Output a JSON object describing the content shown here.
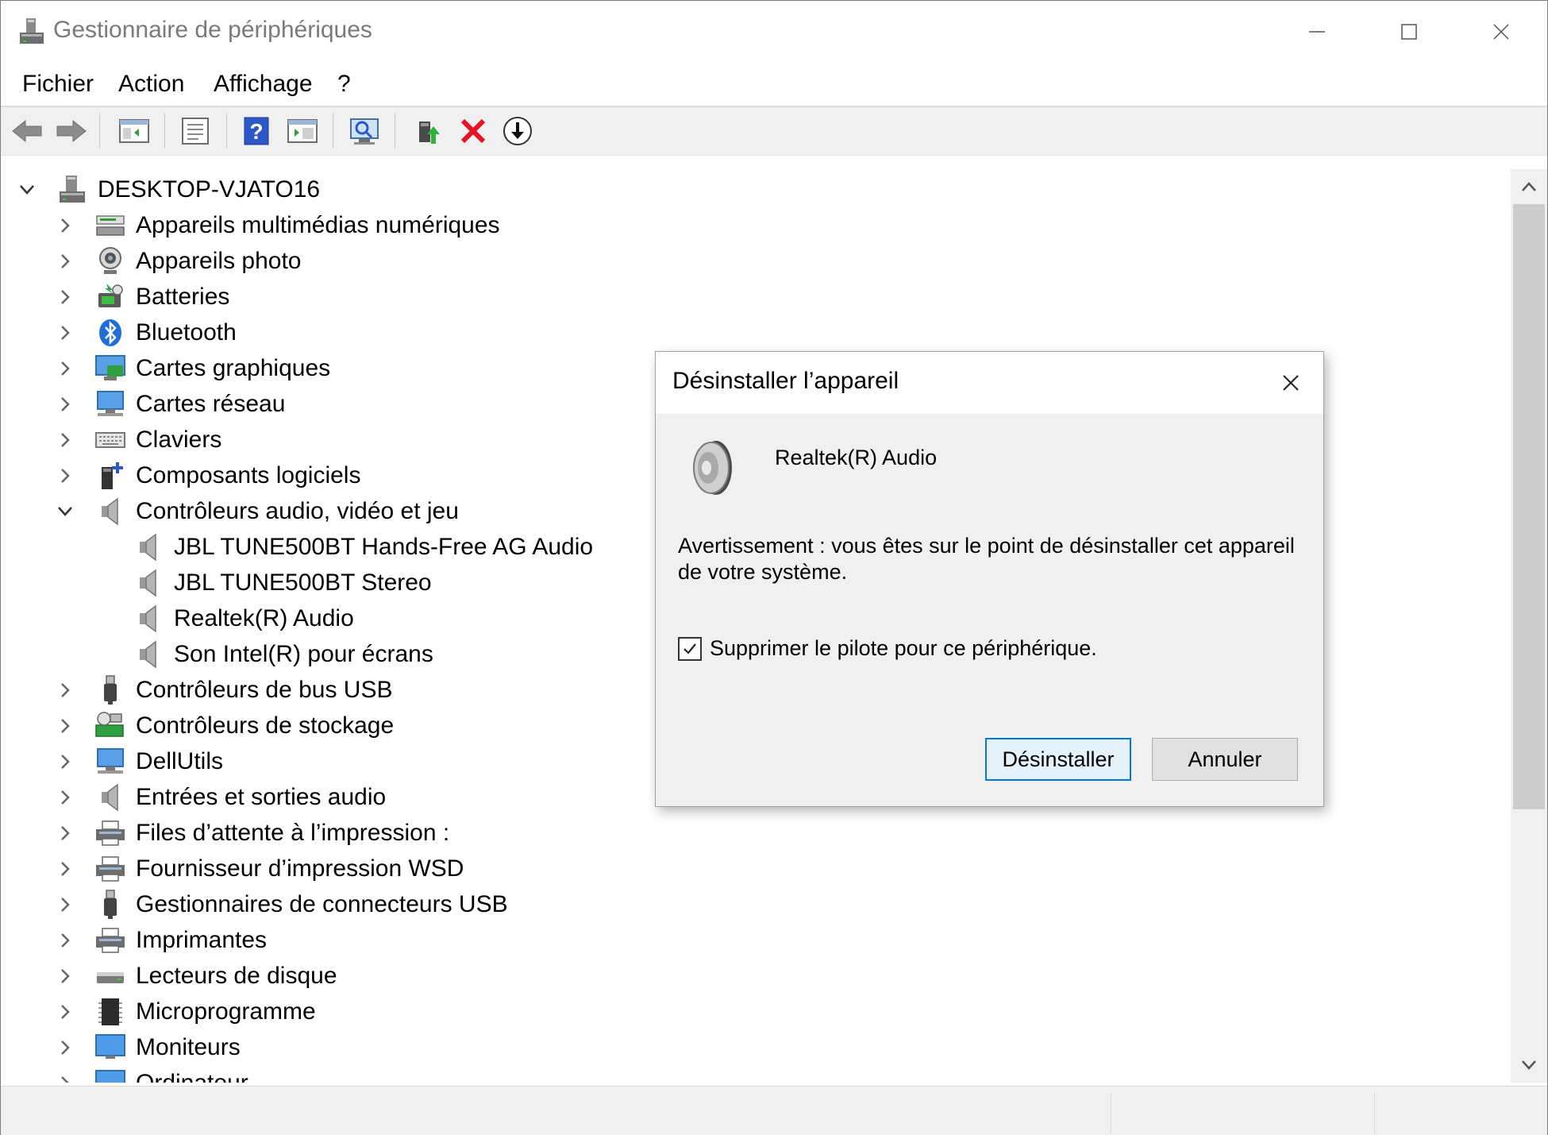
{
  "window": {
    "title": "Gestionnaire de périphériques"
  },
  "menu": [
    "Fichier",
    "Action",
    "Affichage",
    "?"
  ],
  "toolbar": {
    "buttons": [
      "back-arrow-icon",
      "forward-arrow-icon",
      "console-tree-icon",
      "properties-icon",
      "help-icon",
      "view-icon",
      "scan-hardware-icon",
      "update-driver-icon",
      "uninstall-device-icon",
      "disable-device-icon"
    ]
  },
  "tree": {
    "root": "DESKTOP-VJATO16",
    "items": [
      "Appareils multimédias numériques",
      "Appareils photo",
      "Batteries",
      "Bluetooth",
      "Cartes graphiques",
      "Cartes réseau",
      "Claviers",
      "Composants logiciels",
      "Contrôleurs audio, vidéo et jeu",
      "JBL TUNE500BT Hands-Free AG Audio",
      "JBL TUNE500BT Stereo",
      "Realtek(R) Audio",
      "Son Intel(R) pour écrans",
      "Contrôleurs de bus USB",
      "Contrôleurs de stockage",
      "DellUtils",
      "Entrées et sorties audio",
      "Files d’attente à l’impression :",
      "Fournisseur d’impression WSD",
      "Gestionnaires de connecteurs USB",
      "Imprimantes",
      "Lecteurs de disque",
      "Microprogramme",
      "Moniteurs",
      "Ordinateur"
    ]
  },
  "dialog": {
    "title": "Désinstaller l’appareil",
    "device_name": "Realtek(R) Audio",
    "warning": "Avertissement : vous êtes sur le point de désinstaller cet appareil de votre système.",
    "checkbox_label": "Supprimer le pilote pour ce périphérique.",
    "checkbox_checked": true,
    "uninstall_button": "Désinstaller",
    "cancel_button": "Annuler"
  },
  "colors": {
    "accent": "#0078d7",
    "title_gray": "#7a7a7a",
    "delete_red": "#e81123"
  }
}
